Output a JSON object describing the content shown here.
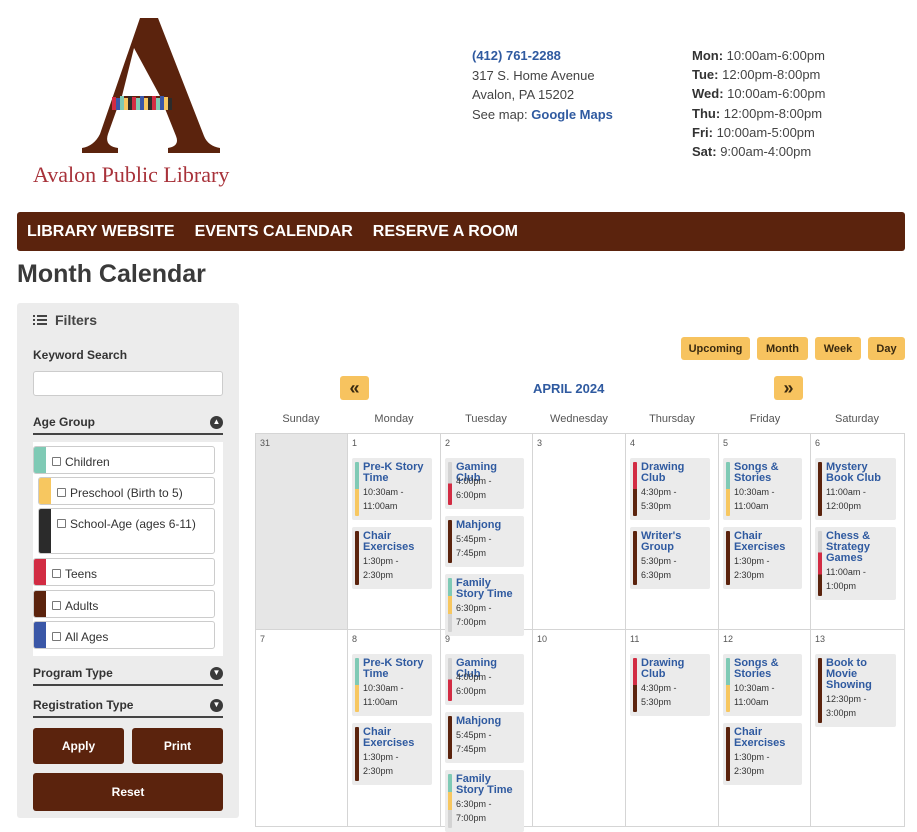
{
  "header": {
    "logo_text": "Avalon Public Library",
    "phone": "(412) 761-2288",
    "address_line1": "317 S. Home Avenue",
    "address_line2": "Avalon, PA 15202",
    "see_map": "See map:",
    "map_link": "Google Maps",
    "hours": [
      {
        "day": "Mon:",
        "time": "10:00am-6:00pm"
      },
      {
        "day": "Tue:",
        "time": "12:00pm-8:00pm"
      },
      {
        "day": "Wed:",
        "time": "10:00am-6:00pm"
      },
      {
        "day": "Thu:",
        "time": "12:00pm-8:00pm"
      },
      {
        "day": "Fri:",
        "time": "10:00am-5:00pm"
      },
      {
        "day": "Sat:",
        "time": "9:00am-4:00pm"
      }
    ]
  },
  "nav": [
    "LIBRARY WEBSITE",
    "EVENTS CALENDAR",
    "RESERVE A ROOM"
  ],
  "page_title": "Month Calendar",
  "sidebar": {
    "filters": "Filters",
    "keyword_label": "Keyword Search",
    "keyword_value": "",
    "age_group": "Age Group",
    "age_items": [
      {
        "label": "Children",
        "color": "#7fcab5"
      },
      {
        "label": "Preschool (Birth to 5)",
        "color": "#f7c760"
      },
      {
        "label": "School-Age (ages 6-11)",
        "color": "#2b2b2b"
      },
      {
        "label": "Teens",
        "color": "#d22c43"
      },
      {
        "label": "Adults",
        "color": "#5b230d"
      },
      {
        "label": "All Ages",
        "color": "#3a57a7"
      }
    ],
    "program_type": "Program Type",
    "registration_type": "Registration Type",
    "apply": "Apply",
    "print": "Print",
    "reset": "Reset"
  },
  "views": [
    "Upcoming",
    "Month",
    "Week",
    "Day"
  ],
  "prev_icon": "«",
  "next_icon": "»",
  "month_label": "APRIL 2024",
  "weekdays": [
    "Sunday",
    "Monday",
    "Tuesday",
    "Wednesday",
    "Thursday",
    "Friday",
    "Saturday"
  ],
  "weeks": [
    {
      "days": [
        {
          "num": "31",
          "prev": true,
          "events": []
        },
        {
          "num": "1",
          "events": [
            {
              "title": "Pre-K Story Time",
              "time": [
                "10:30am -",
                "11:00am"
              ],
              "colors": [
                "#7fcab5",
                "#f7c760"
              ]
            },
            {
              "title": "Chair Exercises",
              "time": [
                "1:30pm -",
                "2:30pm"
              ],
              "colors": [
                "#5b230d"
              ]
            }
          ]
        },
        {
          "num": "2",
          "events": [
            {
              "title": "Gaming Club",
              "time": [
                "4:00pm -",
                "6:00pm"
              ],
              "colors": [
                "#d3d3d3",
                "#d22c43"
              ]
            },
            {
              "title": "Mahjong",
              "time": [
                "5:45pm -",
                "7:45pm"
              ],
              "colors": [
                "#5b230d"
              ]
            },
            {
              "title": "Family Story Time",
              "time": [
                "6:30pm -",
                "7:00pm"
              ],
              "colors": [
                "#7fcab5",
                "#f7c760",
                "#d3d3d3"
              ]
            }
          ]
        },
        {
          "num": "3",
          "events": []
        },
        {
          "num": "4",
          "events": [
            {
              "title": "Drawing Club",
              "time": [
                "4:30pm -",
                "5:30pm"
              ],
              "colors": [
                "#d22c43",
                "#5b230d"
              ]
            },
            {
              "title": "Writer's Group",
              "time": [
                "5:30pm -",
                "6:30pm"
              ],
              "colors": [
                "#5b230d"
              ]
            }
          ]
        },
        {
          "num": "5",
          "events": [
            {
              "title": "Songs & Stories",
              "time": [
                "10:30am -",
                "11:00am"
              ],
              "colors": [
                "#7fcab5",
                "#f7c760"
              ]
            },
            {
              "title": "Chair Exercises",
              "time": [
                "1:30pm -",
                "2:30pm"
              ],
              "colors": [
                "#5b230d"
              ]
            }
          ]
        },
        {
          "num": "6",
          "events": [
            {
              "title": "Mystery Book Club",
              "time": [
                "11:00am -",
                "12:00pm"
              ],
              "colors": [
                "#5b230d"
              ]
            },
            {
              "title": "Chess & Strategy Games",
              "time": [
                "11:00am -",
                "1:00pm"
              ],
              "colors": [
                "#d3d3d3",
                "#d22c43",
                "#5b230d"
              ]
            }
          ]
        }
      ]
    },
    {
      "days": [
        {
          "num": "7",
          "events": []
        },
        {
          "num": "8",
          "events": [
            {
              "title": "Pre-K Story Time",
              "time": [
                "10:30am -",
                "11:00am"
              ],
              "colors": [
                "#7fcab5",
                "#f7c760"
              ]
            },
            {
              "title": "Chair Exercises",
              "time": [
                "1:30pm -",
                "2:30pm"
              ],
              "colors": [
                "#5b230d"
              ]
            }
          ]
        },
        {
          "num": "9",
          "events": [
            {
              "title": "Gaming Club",
              "time": [
                "4:00pm -",
                "6:00pm"
              ],
              "colors": [
                "#d3d3d3",
                "#d22c43"
              ]
            },
            {
              "title": "Mahjong",
              "time": [
                "5:45pm -",
                "7:45pm"
              ],
              "colors": [
                "#5b230d"
              ]
            },
            {
              "title": "Family Story Time",
              "time": [
                "6:30pm -",
                "7:00pm"
              ],
              "colors": [
                "#7fcab5",
                "#f7c760",
                "#d3d3d3"
              ]
            }
          ]
        },
        {
          "num": "10",
          "events": []
        },
        {
          "num": "11",
          "events": [
            {
              "title": "Drawing Club",
              "time": [
                "4:30pm -",
                "5:30pm"
              ],
              "colors": [
                "#d22c43",
                "#5b230d"
              ]
            }
          ]
        },
        {
          "num": "12",
          "events": [
            {
              "title": "Songs & Stories",
              "time": [
                "10:30am -",
                "11:00am"
              ],
              "colors": [
                "#7fcab5",
                "#f7c760"
              ]
            },
            {
              "title": "Chair Exercises",
              "time": [
                "1:30pm -",
                "2:30pm"
              ],
              "colors": [
                "#5b230d"
              ]
            }
          ]
        },
        {
          "num": "13",
          "events": [
            {
              "title": "Book to Movie Showing",
              "time": [
                "12:30pm -",
                "3:00pm"
              ],
              "colors": [
                "#5b230d"
              ]
            }
          ]
        }
      ]
    }
  ]
}
